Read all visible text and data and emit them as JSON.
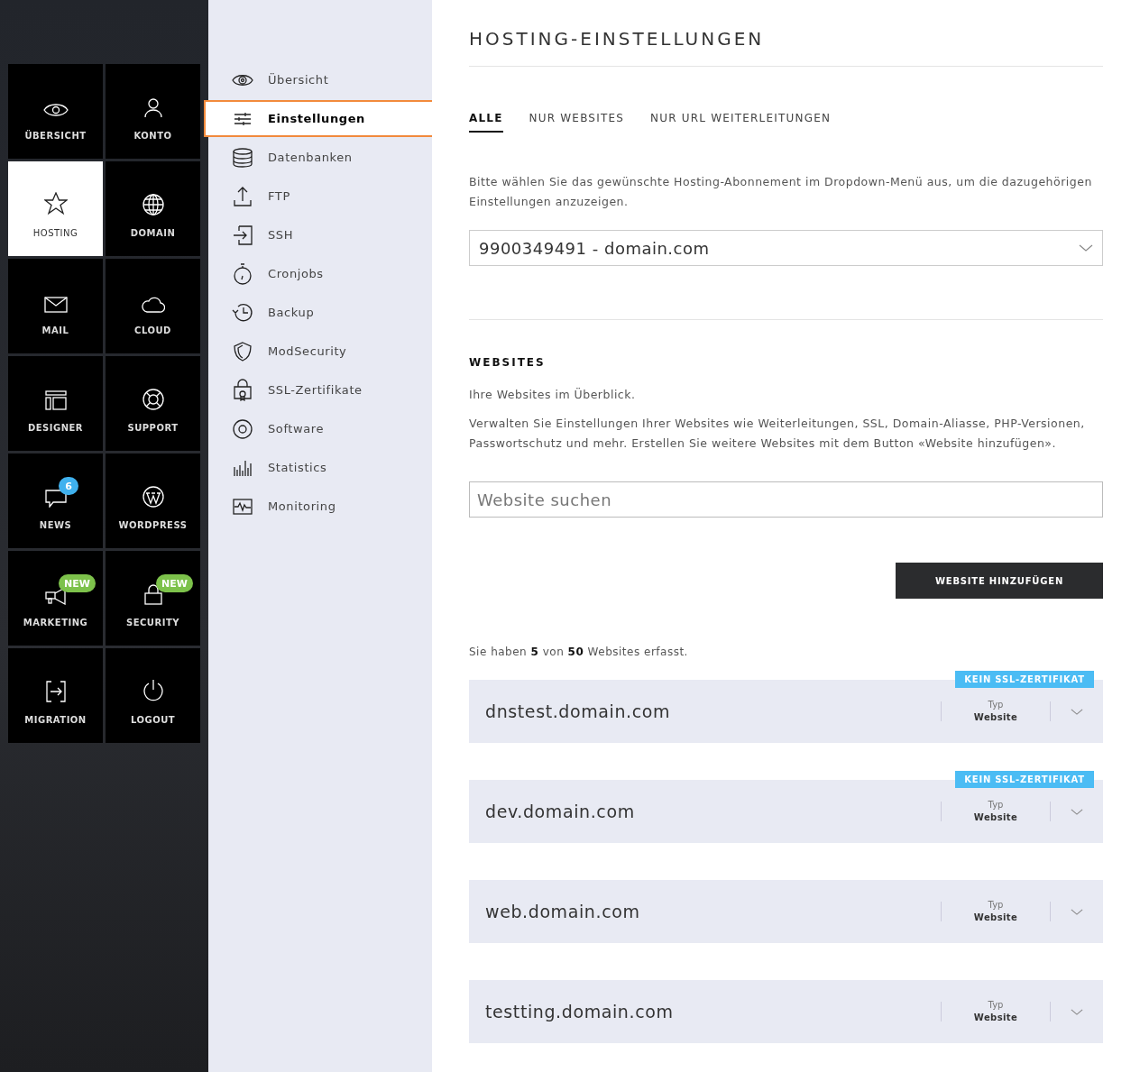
{
  "main_nav": {
    "items": [
      {
        "label": "ÜBERSICHT",
        "selected": false
      },
      {
        "label": "KONTO",
        "selected": false
      },
      {
        "label": "HOSTING",
        "selected": true
      },
      {
        "label": "DOMAIN",
        "selected": false
      },
      {
        "label": "MAIL",
        "selected": false
      },
      {
        "label": "CLOUD",
        "selected": false
      },
      {
        "label": "DESIGNER",
        "selected": false
      },
      {
        "label": "SUPPORT",
        "selected": false
      },
      {
        "label": "NEWS",
        "selected": false,
        "badge": {
          "kind": "count",
          "text": "6"
        }
      },
      {
        "label": "WORDPRESS",
        "selected": false
      },
      {
        "label": "MARKETING",
        "selected": false,
        "badge": {
          "kind": "new",
          "text": "NEW"
        }
      },
      {
        "label": "SECURITY",
        "selected": false,
        "badge": {
          "kind": "new",
          "text": "NEW"
        }
      },
      {
        "label": "MIGRATION",
        "selected": false
      },
      {
        "label": "LOGOUT",
        "selected": false
      }
    ]
  },
  "sub_nav": {
    "items": [
      {
        "label": "Übersicht",
        "selected": false
      },
      {
        "label": "Einstellungen",
        "selected": true
      },
      {
        "label": "Datenbanken",
        "selected": false
      },
      {
        "label": "FTP",
        "selected": false
      },
      {
        "label": "SSH",
        "selected": false
      },
      {
        "label": "Cronjobs",
        "selected": false
      },
      {
        "label": "Backup",
        "selected": false
      },
      {
        "label": "ModSecurity",
        "selected": false
      },
      {
        "label": "SSL-Zertifikate",
        "selected": false
      },
      {
        "label": "Software",
        "selected": false
      },
      {
        "label": "Statistics",
        "selected": false
      },
      {
        "label": "Monitoring",
        "selected": false
      }
    ]
  },
  "page_title": "HOSTING-EINSTELLUNGEN",
  "tabs": [
    {
      "label": "ALLE",
      "selected": true
    },
    {
      "label": "NUR WEBSITES",
      "selected": false
    },
    {
      "label": "NUR URL WEITERLEITUNGEN",
      "selected": false
    }
  ],
  "intro": "Bitte wählen Sie das gewünschte Hosting-Abonnement im Dropdown-Menü aus, um die dazugehörigen Einstellungen anzuzeigen.",
  "subscription_select": {
    "value": "9900349491 - domain.com"
  },
  "websites": {
    "heading": "WEBSITES",
    "subtitle": "Ihre Websites im Überblick.",
    "description": "Verwalten Sie Einstellungen Ihrer Websites wie Weiterleitungen, SSL, Domain-Aliasse, PHP-Versionen, Passwortschutz und mehr. Erstellen Sie weitere Websites mit dem Button «Website hinzufügen».",
    "search": {
      "placeholder": "Website suchen"
    },
    "add_button": "WEBSITE HINZUFÜGEN",
    "count_text": "Sie haben **5** von **50** Websites erfasst.",
    "items": [
      {
        "name": "dnstest.domain.com",
        "ssl_badge": "KEIN SSL-ZERTIFIKAT",
        "type_label": "Typ",
        "type_value": "Website"
      },
      {
        "name": "dev.domain.com",
        "ssl_badge": "KEIN SSL-ZERTIFIKAT",
        "type_label": "Typ",
        "type_value": "Website"
      },
      {
        "name": "web.domain.com",
        "type_label": "Typ",
        "type_value": "Website"
      },
      {
        "name": "testting.domain.com",
        "type_label": "Typ",
        "type_value": "Website"
      }
    ]
  }
}
